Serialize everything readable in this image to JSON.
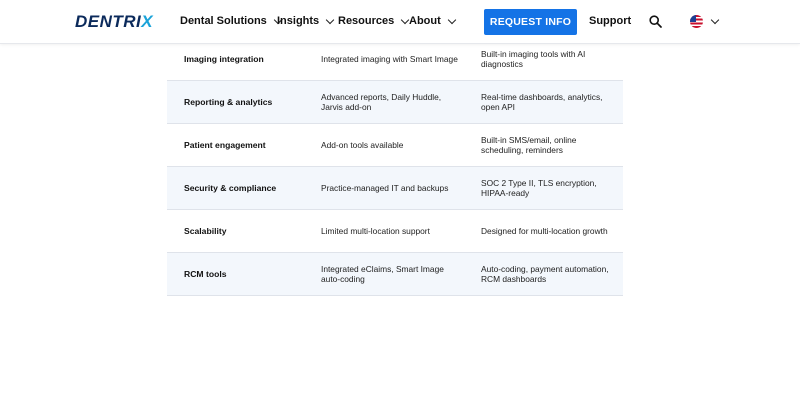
{
  "header": {
    "logo": "DENTRIX",
    "nav": [
      {
        "label": "Dental Solutions"
      },
      {
        "label": "Insights"
      },
      {
        "label": "Resources"
      },
      {
        "label": "About"
      }
    ],
    "cta_label": "REQUEST INFO",
    "support_label": "Support",
    "search_icon": "search-icon",
    "language_icon": "us-flag-icon",
    "accent_color": "#1473e6"
  },
  "comparison_table": {
    "rows": [
      {
        "feature": "Imaging integration",
        "col_b": "Integrated imaging with Smart Image",
        "col_c": "Built-in imaging tools with AI diagnostics"
      },
      {
        "feature": "Reporting & analytics",
        "col_b": "Advanced reports, Daily Huddle, Jarvis add-on",
        "col_c": "Real-time dashboards, analytics, open API"
      },
      {
        "feature": "Patient engagement",
        "col_b": "Add-on tools available",
        "col_c": "Built-in SMS/email, online scheduling, reminders"
      },
      {
        "feature": "Security & compliance",
        "col_b": "Practice-managed IT and backups",
        "col_c": "SOC 2 Type II, TLS encryption, HIPAA-ready"
      },
      {
        "feature": "Scalability",
        "col_b": "Limited multi-location support",
        "col_c": "Designed for multi-location growth"
      },
      {
        "feature": "RCM tools",
        "col_b": "Integrated eClaims, Smart Image auto-coding",
        "col_c": "Auto-coding, payment automation, RCM dashboards"
      }
    ]
  }
}
